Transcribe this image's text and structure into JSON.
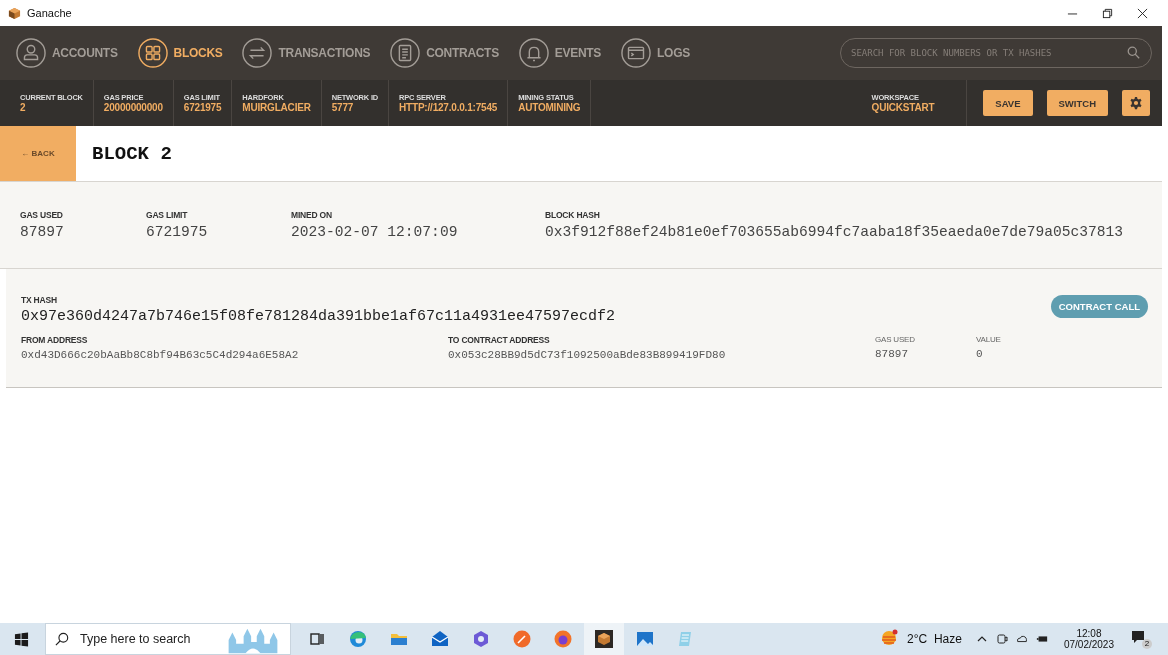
{
  "window": {
    "title": "Ganache"
  },
  "nav": [
    {
      "label": "ACCOUNTS",
      "selected": false
    },
    {
      "label": "BLOCKS",
      "selected": true
    },
    {
      "label": "TRANSACTIONS",
      "selected": false
    },
    {
      "label": "CONTRACTS",
      "selected": false
    },
    {
      "label": "EVENTS",
      "selected": false
    },
    {
      "label": "LOGS",
      "selected": false
    }
  ],
  "search": {
    "placeholder": "SEARCH FOR BLOCK NUMBERS OR TX HASHES"
  },
  "stats": [
    {
      "label": "CURRENT BLOCK",
      "value": "2"
    },
    {
      "label": "GAS PRICE",
      "value": "20000000000"
    },
    {
      "label": "GAS LIMIT",
      "value": "6721975"
    },
    {
      "label": "HARDFORK",
      "value": "MUIRGLACIER"
    },
    {
      "label": "NETWORK ID",
      "value": "5777"
    },
    {
      "label": "RPC SERVER",
      "value": "HTTP://127.0.0.1:7545"
    },
    {
      "label": "MINING STATUS",
      "value": "AUTOMINING"
    }
  ],
  "workspace": {
    "label": "WORKSPACE",
    "value": "QUICKSTART"
  },
  "actions": [
    "SAVE",
    "SWITCH"
  ],
  "back": "← BACK",
  "page_title": "BLOCK 2",
  "block_info": [
    {
      "label": "GAS USED",
      "value": "87897"
    },
    {
      "label": "GAS LIMIT",
      "value": "6721975"
    },
    {
      "label": "MINED ON",
      "value": "2023-02-07 12:07:09"
    },
    {
      "label": "BLOCK HASH",
      "value": "0x3f912f88ef24b81e0ef703655ab6994fc7aaba18f35eaeda0e7de79a05c37813"
    }
  ],
  "transaction": {
    "hash_label": "TX HASH",
    "hash": "0x97e360d4247a7b746e15f08fe781284da391bbe1af67c11a4931ee47597ecdf2",
    "type": "CONTRACT CALL",
    "fields": [
      {
        "label": "FROM ADDRESS",
        "value": "0xd43D666c20bAaBb8C8bf94B63c5C4d294a6E58A2"
      },
      {
        "label": "TO CONTRACT ADDRESS",
        "value": "0x053c28BB9d5dC73f1092500aBde83B899419FD80"
      },
      {
        "label": "GAS USED",
        "value": "87897"
      },
      {
        "label": "VALUE",
        "value": "0"
      }
    ]
  },
  "taskbar": {
    "search_placeholder": "Type here to search",
    "weather": "2°C  Haze",
    "time": "12:08",
    "date": "07/02/2023",
    "notifications": "2"
  }
}
